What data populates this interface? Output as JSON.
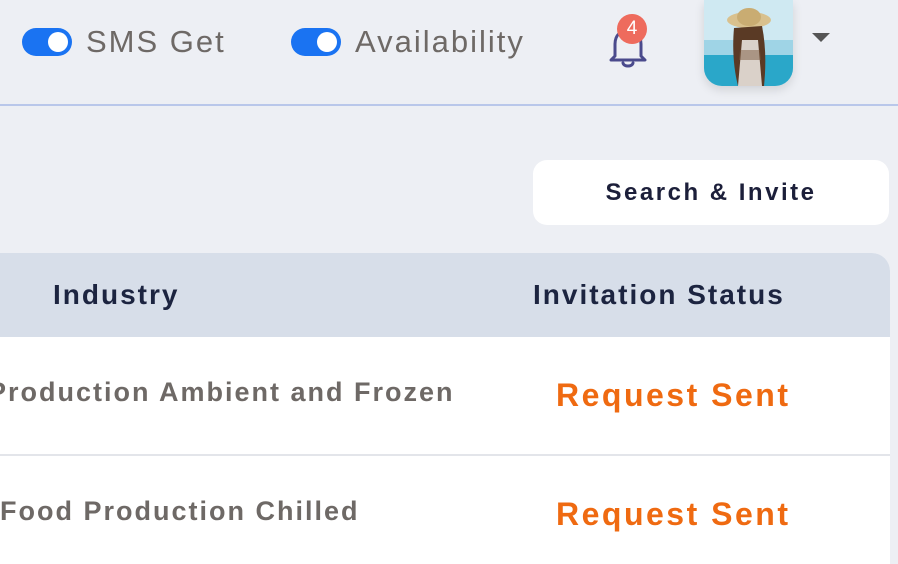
{
  "header": {
    "sms_toggle": {
      "label": "SMS Get",
      "on": true
    },
    "availability_toggle": {
      "label": "Availability",
      "on": true
    },
    "notifications": {
      "count": "4"
    },
    "user_menu": {
      "avatar_icon": "user-avatar",
      "caret_icon": "chevron-down-icon"
    }
  },
  "actions": {
    "search_invite_label": "Search & Invite"
  },
  "table": {
    "columns": [
      "Industry",
      "Invitation Status"
    ],
    "rows": [
      {
        "industry": "Production Ambient and Frozen",
        "status": "Request Sent"
      },
      {
        "industry": "Food Production Chilled",
        "status": "Request Sent"
      }
    ]
  },
  "colors": {
    "toggle_on": "#1a73f2",
    "badge": "#ee6b5d",
    "status_sent": "#ef6a11",
    "header_bg": "#d7dee9"
  }
}
